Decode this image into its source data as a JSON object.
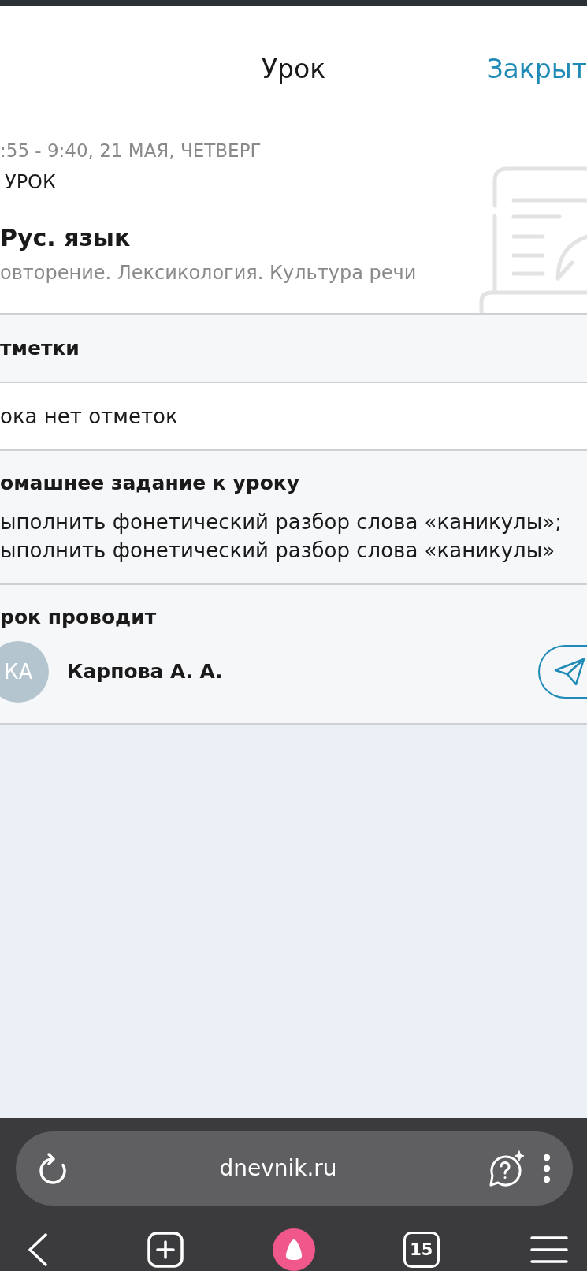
{
  "header": {
    "title": "Урок",
    "close_label": "Закрыт"
  },
  "lesson": {
    "time": ":55 - 9:40, 21 МАЯ, ЧЕТВЕРГ",
    "number": "УРОК",
    "subject": "Рус. язык",
    "topic": "овторение. Лексикология. Культура речи"
  },
  "marks": {
    "heading": "тметки",
    "empty_text": "ока нет отметок"
  },
  "homework": {
    "heading": "омашнее задание к уроку",
    "items": [
      "ыполнить фонетический разбор слова «каникулы»;",
      "ыполнить фонетический разбор слова «каникулы»"
    ]
  },
  "teacher": {
    "heading": "рок проводит",
    "initials": "КА",
    "name": "Карпова А. А."
  },
  "browser": {
    "url": "dnevnik.ru",
    "tab_count": "15"
  }
}
